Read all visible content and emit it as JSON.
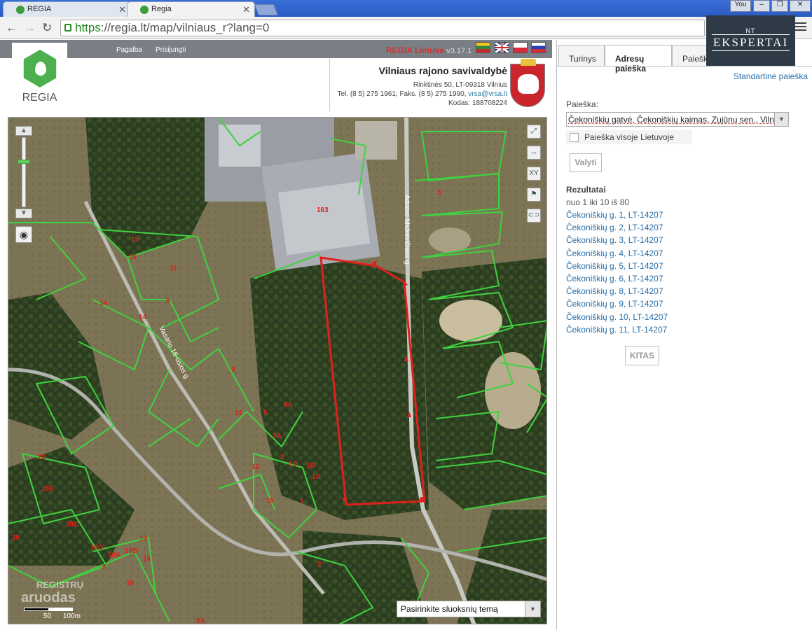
{
  "browser": {
    "tabs": [
      {
        "title": "REGIA"
      },
      {
        "title": "Regia"
      }
    ],
    "user_label": "You",
    "url_scheme": "https",
    "url_rest": "://regia.lt/map/vilniaus_r?lang=0"
  },
  "topnav": {
    "help": "Pagalba",
    "login": "Prisijungti",
    "brand": "REGIA Lietuva",
    "version": "v3.17.1"
  },
  "logo": {
    "text": "REGIA"
  },
  "org": {
    "name": "Vilniaus rajono savivaldybė",
    "address": "Rinktinės 50, LT-09318 Vilnius",
    "phones": "Tel. (8 5) 275 1961; Faks. (8 5) 275 1990,",
    "email": "vrsa@vrsa.lt",
    "code": "Kodas: 188708224"
  },
  "map": {
    "layer_select": "Pasirinkite sluoksnių temą",
    "watermark_top": "REGISTRŲ",
    "watermark_bottom": "aruodas",
    "scale_mid": "50",
    "scale_end": "100m",
    "road_labels": [
      "Adomo Mickevičiaus g.",
      "Vasario 16-osios g."
    ],
    "parcel_numbers": [
      "163",
      "5",
      "15",
      "19",
      "11",
      "9",
      "14",
      "14",
      "9",
      "5A",
      "11",
      "5",
      "3A",
      "3",
      "1C",
      "1B",
      "12",
      "1A",
      "15",
      "1",
      "22",
      "18E",
      "18C",
      "20",
      "18D",
      "18A",
      "18B",
      "14",
      "16",
      "8",
      "10",
      "2",
      "8A"
    ]
  },
  "panel": {
    "tabs": [
      "Turinys",
      "Adresų paieška",
      "Paieška"
    ],
    "std_search": "Standartinė paieška",
    "search_label": "Paieška:",
    "search_value": "Čekoniškių gatvė, Čekoniškių kaimas, Zujūnų sen., Vilniaus r. sav.",
    "lt_checkbox": "Paieška visoje Lietuvoje",
    "clear_button": "Valyti",
    "results_title": "Rezultatai",
    "results_range": "nuo 1 iki 10 iš 80",
    "results": [
      "Čekoniškių g. 1, LT-14207",
      "Čekoniškių g. 2, LT-14207",
      "Čekoniškių g. 3, LT-14207",
      "Čekoniškių g. 4, LT-14207",
      "Čekoniškių g. 5, LT-14207",
      "Čekoniškių g. 6, LT-14207",
      "Čekoniškių g. 8, LT-14207",
      "Čekoniškių g. 9, LT-14207",
      "Čekoniškių g. 10, LT-14207",
      "Čekoniškių g. 11, LT-14207"
    ],
    "next_button": "KITAS"
  },
  "overlay_logo": {
    "small": "NT",
    "main": "EKSPERTAI"
  },
  "colors": {
    "brand_red": "#d3312c",
    "link_blue": "#2a6fa8",
    "parcel_green": "#3fd23f",
    "plot_red": "#e0201c"
  }
}
